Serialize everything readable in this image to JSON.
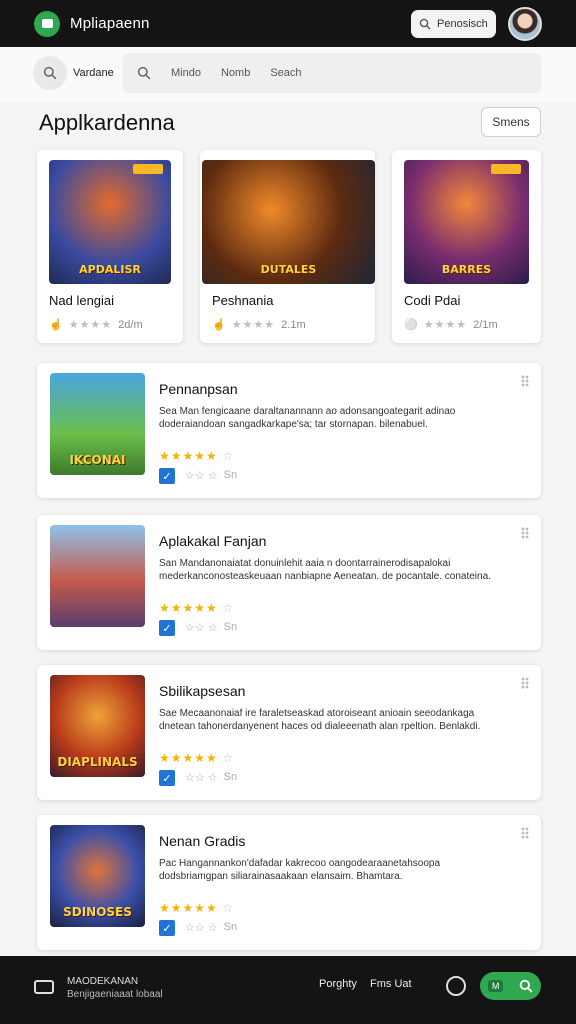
{
  "header": {
    "app_name": "Mpliapaenn",
    "search_label": "Penosisch"
  },
  "search": {
    "label": "Vardane",
    "tabs": [
      "Mindo",
      "Nomb",
      "Seach"
    ]
  },
  "section": {
    "title": "Applkardenna",
    "button_label": "Smens"
  },
  "featured": [
    {
      "name": "Nad lengiai",
      "meta": "2d/m",
      "img_title": "APDALISR"
    },
    {
      "name": "Peshnania",
      "meta": "2.1m",
      "img_title": "DUTALES"
    },
    {
      "name": "Codi Pdai",
      "meta": "2/1m",
      "img_title": "BARRES"
    }
  ],
  "items": [
    {
      "title": "Pennanpsan",
      "desc": "Sea Man fengicaane daraltanannann ao adonsangoategarit adinao doderaiandoan sangadkarkape'sa; tar stornapan. bilenabuel.",
      "img_title": "IKCONAI",
      "rate": "Sn"
    },
    {
      "title": "Aplakakal Fanjan",
      "desc": "San Mandanonaiatat donuinlehit aaia n doontarrainerodisapalokai mederkanconosteaskeuaan nanbiapne Aeneatan. de pocantale. conateina.",
      "img_title": "",
      "rate": "Sn"
    },
    {
      "title": "Sbilikapsesan",
      "desc": "Sae Mecaanonaiaf ire faraletseaskad atoroiseant anioain seeodankaga dnetean tahonerdanyenent haces od dialeeenath alan rpeltion. Benlakdi.",
      "img_title": "DIAPLINALS",
      "rate": "Sn"
    },
    {
      "title": "Nenan Gradis",
      "desc": "Pac Hangannankon'dafadar kakrecoo oangodearaanetahsoopa dodsbriamgpan siliarainasaakaan elansaim. Bhamtara.",
      "img_title": "SDINOSES",
      "rate": "Sn"
    }
  ],
  "footer": {
    "title": "MAODEKANAN",
    "subtitle": "Benjigaeniaaat lobaal",
    "link1": "Porghty",
    "link2": "Fms Uat",
    "cta_tag": "M"
  },
  "colors": {
    "accent": "#2fa84f",
    "topbar": "#141414",
    "check": "#1f74d6",
    "star": "#f5b301"
  }
}
